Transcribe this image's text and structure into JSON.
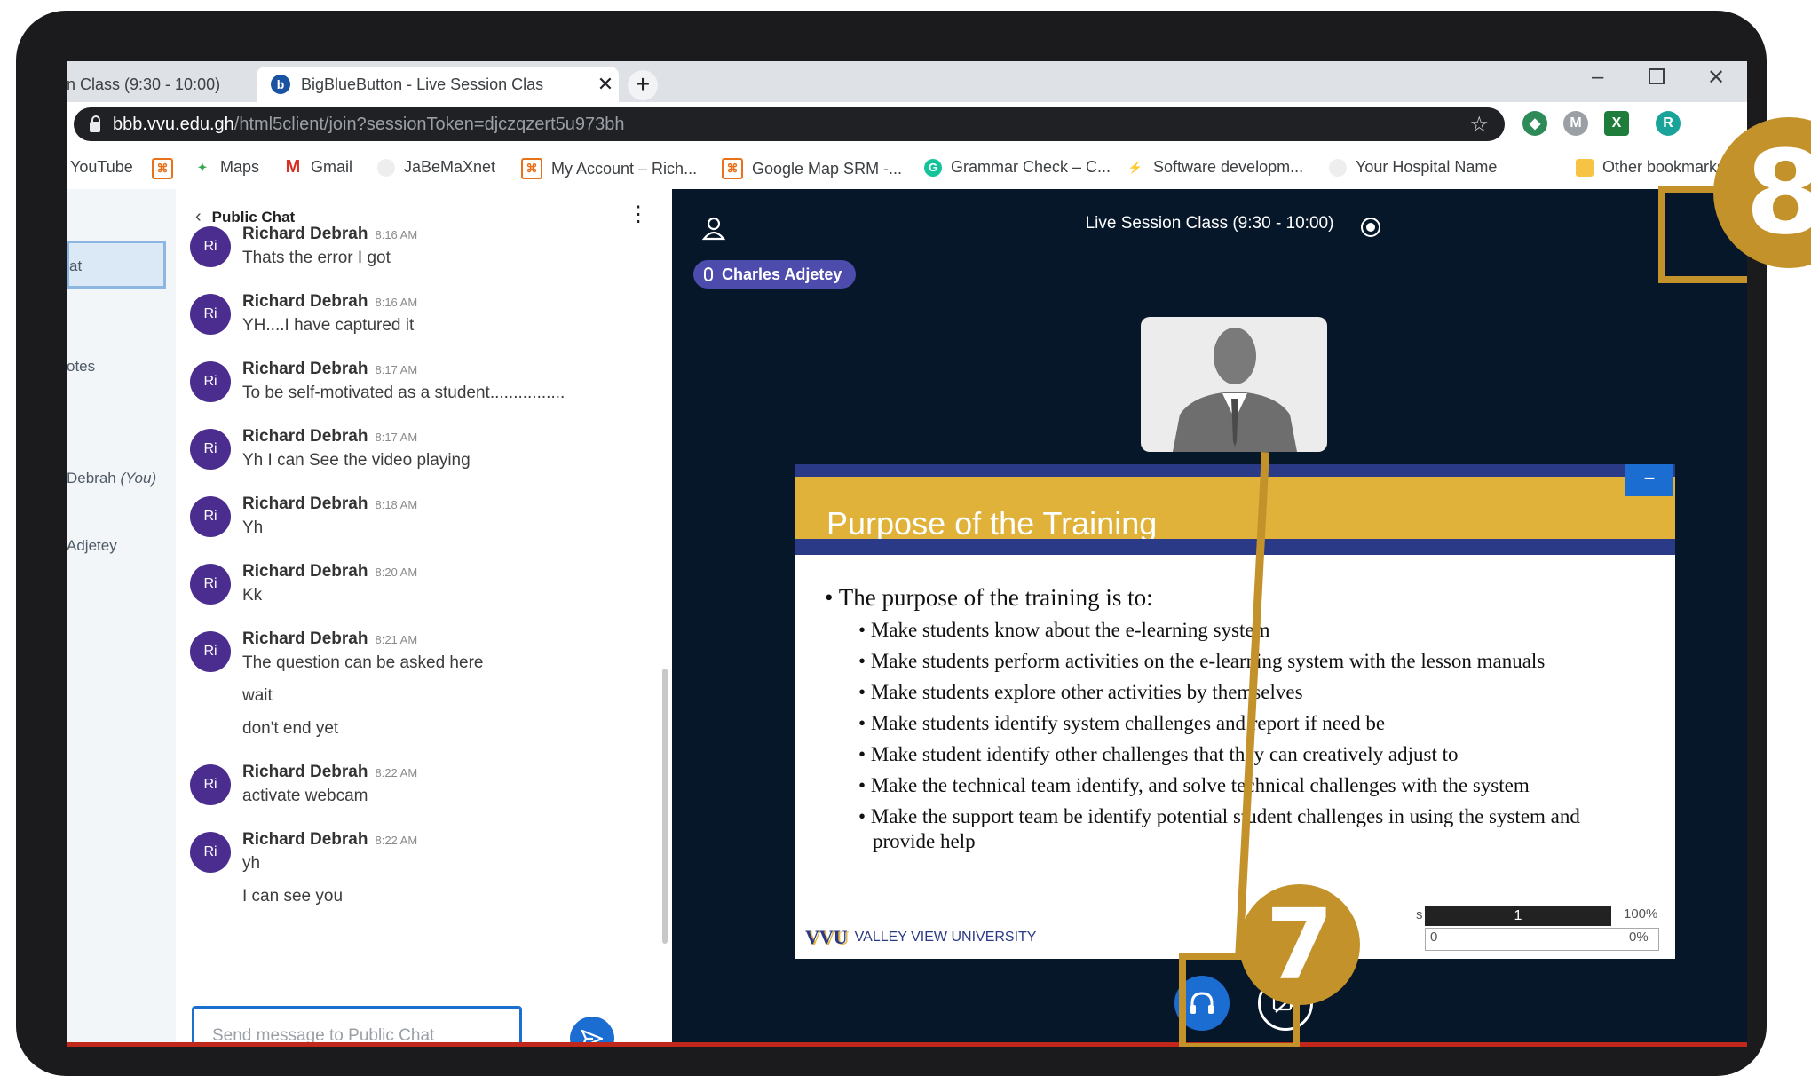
{
  "browser": {
    "tabs": [
      {
        "title": "n Class (9:30 - 10:00)",
        "active": false
      },
      {
        "title": "BigBlueButton - Live Session Clas",
        "active": true
      }
    ],
    "new_tab": "+",
    "close_glyph": "✕",
    "url_host": "bbb.vvu.edu.gh",
    "url_path": "/html5client/join?sessionToken=djczqzert5u973bh",
    "profile_initial": "R",
    "bookmarks": [
      "YouTube",
      "Maps",
      "Gmail",
      "JaBeMaXnet",
      "My Account – Rich...",
      "Google Map SRM -...",
      "Grammar Check – C...",
      "Software developm...",
      "Your Hospital Name",
      "Other bookmarks"
    ]
  },
  "userlist": {
    "items": [
      "at",
      "otes",
      "Debrah",
      "(You)",
      "Adjetey"
    ]
  },
  "chat": {
    "title": "Public Chat",
    "messages": [
      {
        "initials": "Ri",
        "name": "Richard Debrah",
        "time": "8:16 AM",
        "lines": [
          "Thats the error I got"
        ]
      },
      {
        "initials": "Ri",
        "name": "Richard Debrah",
        "time": "8:16 AM",
        "lines": [
          "YH....I have captured it"
        ]
      },
      {
        "initials": "Ri",
        "name": "Richard Debrah",
        "time": "8:17 AM",
        "lines": [
          "To be self-motivated as a student................"
        ]
      },
      {
        "initials": "Ri",
        "name": "Richard Debrah",
        "time": "8:17 AM",
        "lines": [
          "Yh I can See the video playing"
        ]
      },
      {
        "initials": "Ri",
        "name": "Richard Debrah",
        "time": "8:18 AM",
        "lines": [
          "Yh"
        ]
      },
      {
        "initials": "Ri",
        "name": "Richard Debrah",
        "time": "8:20 AM",
        "lines": [
          "Kk"
        ]
      },
      {
        "initials": "Ri",
        "name": "Richard Debrah",
        "time": "8:21 AM",
        "lines": [
          "The question can be asked here",
          "wait",
          "don't end yet"
        ]
      },
      {
        "initials": "Ri",
        "name": "Richard Debrah",
        "time": "8:22 AM",
        "lines": [
          "activate webcam"
        ]
      },
      {
        "initials": "Ri",
        "name": "Richard Debrah",
        "time": "8:22 AM",
        "lines": [
          "yh",
          "I can see you"
        ]
      }
    ],
    "input_placeholder": "Send message to Public Chat"
  },
  "session": {
    "title": "Live Session Class (9:30 - 10:00)",
    "talker": "Charles Adjetey"
  },
  "slide": {
    "title": "Purpose of the Training",
    "lead": "The purpose of the training is to:",
    "bullets": [
      "Make students know about the e-learning system",
      "Make students perform activities on the e-learning system with the lesson manuals",
      "Make students explore other activities by themselves",
      "Make students identify system challenges and report if need be",
      "Make student identify other challenges that they can creatively adjust to",
      "Make the technical team identify, and solve technical challenges with the system",
      "Make the support team be identify potential student challenges in using the system and provide help"
    ],
    "logo_text": "VALLEY VIEW UNIVERSITY",
    "logo_mark": "VVU",
    "minimize": "−",
    "zoom": {
      "page": "1",
      "percent": "100%",
      "min": "0",
      "max": "0%",
      "label_fragment": "s"
    }
  },
  "annotations": {
    "seven": "7",
    "eight": "8"
  },
  "colors": {
    "annotation": "#c4922a",
    "main_bg": "#06172a",
    "accent": "#1b6dd1",
    "avatar": "#4a2d8f",
    "slide_gold": "#e1b23a",
    "slide_navy": "#2b3a86"
  }
}
